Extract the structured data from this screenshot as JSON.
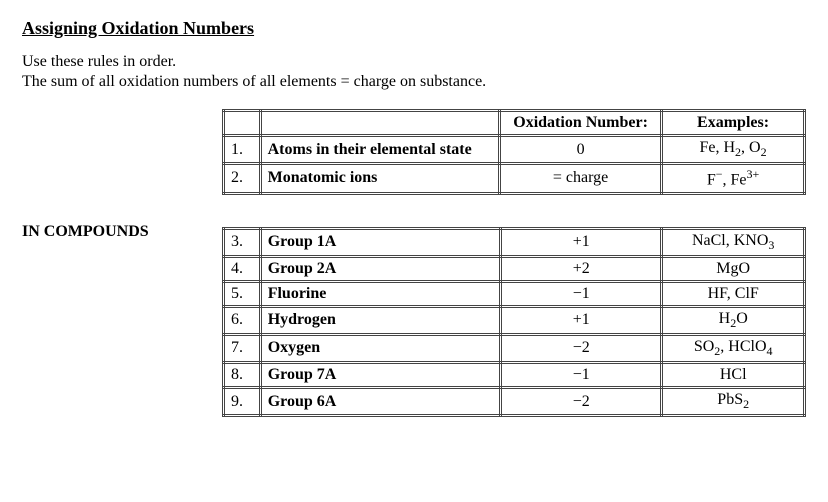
{
  "title": "Assigning Oxidation Numbers",
  "intro": {
    "line1": "Use these rules in order.",
    "line2": "The sum of all oxidation numbers of all elements = charge on substance."
  },
  "headers": {
    "oxnum": "Oxidation Number:",
    "examples": "Examples:"
  },
  "section_label": "IN COMPOUNDS",
  "chart_data": {
    "type": "table",
    "tables": [
      {
        "rows": [
          {
            "num": "1.",
            "desc": "Atoms in their elemental state",
            "ox": "0",
            "ex_html": "Fe, H<sub>2</sub>, O<sub>2</sub>"
          },
          {
            "num": "2.",
            "desc": "Monatomic ions",
            "ox": "= charge",
            "ex_html": "F<sup>−</sup>, Fe<sup>3+</sup>"
          }
        ]
      },
      {
        "rows": [
          {
            "num": "3.",
            "desc": "Group 1A",
            "ox": "+1",
            "ex_html": "NaCl, KNO<sub>3</sub>"
          },
          {
            "num": "4.",
            "desc": "Group 2A",
            "ox": "+2",
            "ex_html": "MgO"
          },
          {
            "num": "5.",
            "desc": "Fluorine",
            "ox": "−1",
            "ex_html": "HF, ClF"
          },
          {
            "num": "6.",
            "desc": "Hydrogen",
            "ox": "+1",
            "ex_html": "H<sub>2</sub>O"
          },
          {
            "num": "7.",
            "desc": "Oxygen",
            "ox": "−2",
            "ex_html": "SO<sub>2</sub>, HClO<sub>4</sub>"
          },
          {
            "num": "8.",
            "desc": "Group 7A",
            "ox": "−1",
            "ex_html": "HCl"
          },
          {
            "num": "9.",
            "desc": "Group 6A",
            "ox": "−2",
            "ex_html": "PbS<sub>2</sub>"
          }
        ]
      }
    ]
  }
}
